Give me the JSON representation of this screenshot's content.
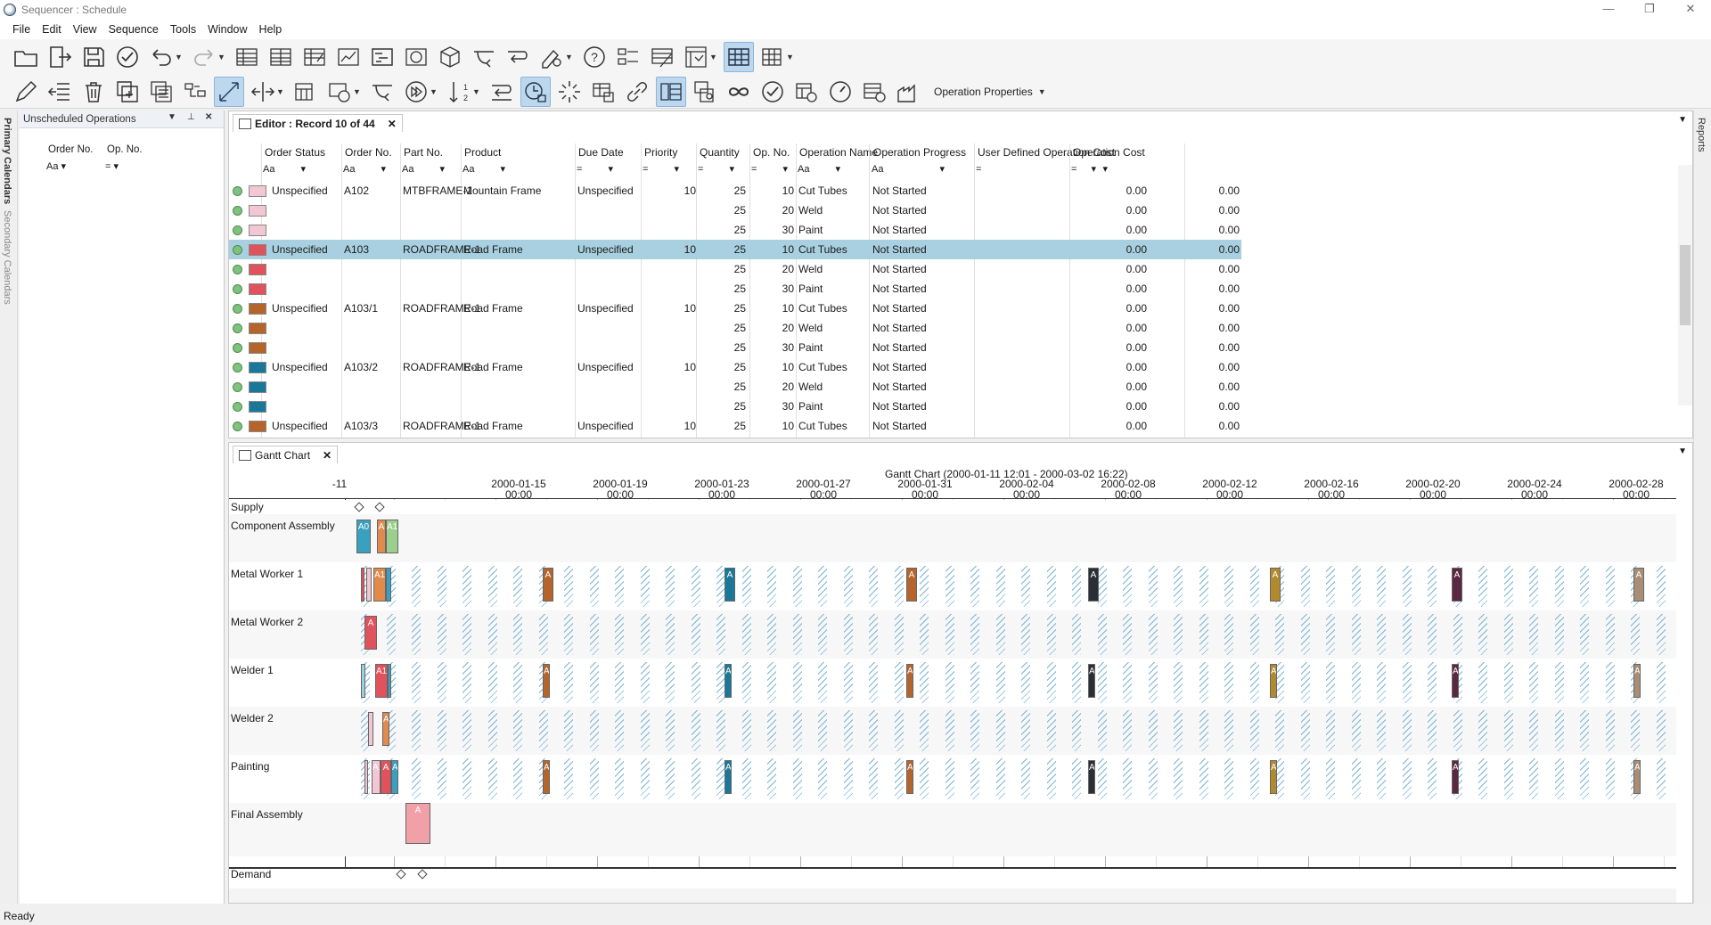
{
  "window": {
    "title": "Sequencer : Schedule",
    "controls": [
      "—",
      "❐",
      "✕"
    ]
  },
  "menu": [
    "File",
    "Edit",
    "View",
    "Sequence",
    "Tools",
    "Window",
    "Help"
  ],
  "toolbar": {
    "op_properties": "Operation Properties"
  },
  "side_tabs": {
    "primary": "Primary Calendars",
    "secondary": "Secondary Calendars",
    "reports": "Reports"
  },
  "unscheduled": {
    "title": "Unscheduled Operations",
    "columns": [
      "Order No.",
      "Op. No."
    ],
    "filters": [
      "Aa ▾",
      "= ▾"
    ]
  },
  "editor": {
    "tab_label": "Editor : Record 10 of 44",
    "columns": [
      "Order Status",
      "Order No.",
      "Part No.",
      "Product",
      "Due Date",
      "Priority",
      "Quantity",
      "Op. No.",
      "Operation Name",
      "Operation Progress",
      "User Defined Operation Cost",
      "Operation Cost"
    ],
    "filters": [
      "Aa",
      "Aa",
      "Aa",
      "Aa",
      "=",
      "=",
      "=",
      "=",
      "Aa",
      "Aa",
      "=",
      "="
    ],
    "rows": [
      {
        "color": "#f2c6d2",
        "status": "Unspecified",
        "order": "A102",
        "part": "MTBFRAME-1",
        "product": "Mountain Frame",
        "due": "Unspecified",
        "priority": "10",
        "qty": "25",
        "op": "10",
        "opname": "Cut Tubes",
        "progress": "Not Started",
        "udcost": "0.00",
        "cost": "0.00"
      },
      {
        "color": "#f2c6d2",
        "status": "",
        "order": "",
        "part": "",
        "product": "",
        "due": "",
        "priority": "",
        "qty": "25",
        "op": "20",
        "opname": "Weld",
        "progress": "Not Started",
        "udcost": "0.00",
        "cost": "0.00"
      },
      {
        "color": "#f2c6d2",
        "status": "",
        "order": "",
        "part": "",
        "product": "",
        "due": "",
        "priority": "",
        "qty": "25",
        "op": "30",
        "opname": "Paint",
        "progress": "Not Started",
        "udcost": "0.00",
        "cost": "0.00"
      },
      {
        "color": "#e0525c",
        "status": "Unspecified",
        "order": "A103",
        "part": "ROADFRAME-1",
        "product": "Road Frame",
        "due": "Unspecified",
        "priority": "10",
        "qty": "25",
        "op": "10",
        "opname": "Cut Tubes",
        "progress": "Not Started",
        "udcost": "0.00",
        "cost": "0.00",
        "selected": true
      },
      {
        "color": "#e0525c",
        "status": "",
        "order": "",
        "part": "",
        "product": "",
        "due": "",
        "priority": "",
        "qty": "25",
        "op": "20",
        "opname": "Weld",
        "progress": "Not Started",
        "udcost": "0.00",
        "cost": "0.00"
      },
      {
        "color": "#e0525c",
        "status": "",
        "order": "",
        "part": "",
        "product": "",
        "due": "",
        "priority": "",
        "qty": "25",
        "op": "30",
        "opname": "Paint",
        "progress": "Not Started",
        "udcost": "0.00",
        "cost": "0.00"
      },
      {
        "color": "#b5642c",
        "status": "Unspecified",
        "order": "A103/1",
        "part": "ROADFRAME-1",
        "product": "Road Frame",
        "due": "Unspecified",
        "priority": "10",
        "qty": "25",
        "op": "10",
        "opname": "Cut Tubes",
        "progress": "Not Started",
        "udcost": "0.00",
        "cost": "0.00"
      },
      {
        "color": "#b5642c",
        "status": "",
        "order": "",
        "part": "",
        "product": "",
        "due": "",
        "priority": "",
        "qty": "25",
        "op": "20",
        "opname": "Weld",
        "progress": "Not Started",
        "udcost": "0.00",
        "cost": "0.00"
      },
      {
        "color": "#b5642c",
        "status": "",
        "order": "",
        "part": "",
        "product": "",
        "due": "",
        "priority": "",
        "qty": "25",
        "op": "30",
        "opname": "Paint",
        "progress": "Not Started",
        "udcost": "0.00",
        "cost": "0.00"
      },
      {
        "color": "#19789a",
        "status": "Unspecified",
        "order": "A103/2",
        "part": "ROADFRAME-1",
        "product": "Road Frame",
        "due": "Unspecified",
        "priority": "10",
        "qty": "25",
        "op": "10",
        "opname": "Cut Tubes",
        "progress": "Not Started",
        "udcost": "0.00",
        "cost": "0.00"
      },
      {
        "color": "#19789a",
        "status": "",
        "order": "",
        "part": "",
        "product": "",
        "due": "",
        "priority": "",
        "qty": "25",
        "op": "20",
        "opname": "Weld",
        "progress": "Not Started",
        "udcost": "0.00",
        "cost": "0.00"
      },
      {
        "color": "#19789a",
        "status": "",
        "order": "",
        "part": "",
        "product": "",
        "due": "",
        "priority": "",
        "qty": "25",
        "op": "30",
        "opname": "Paint",
        "progress": "Not Started",
        "udcost": "0.00",
        "cost": "0.00"
      },
      {
        "color": "#b5642c",
        "status": "Unspecified",
        "order": "A103/3",
        "part": "ROADFRAME-1",
        "product": "Road Frame",
        "due": "Unspecified",
        "priority": "10",
        "qty": "25",
        "op": "10",
        "opname": "Cut Tubes",
        "progress": "Not Started",
        "udcost": "0.00",
        "cost": "0.00"
      }
    ]
  },
  "gantt": {
    "tab_label": "Gantt Chart",
    "range_title": "Gantt Chart  (2000-01-11 12:01 - 2000-03-02 16:22)",
    "dates": [
      "-11",
      "2000-01-15",
      "2000-01-19",
      "2000-01-23",
      "2000-01-27",
      "2000-01-31",
      "2000-02-04",
      "2000-02-08",
      "2000-02-12",
      "2000-02-16",
      "2000-02-20",
      "2000-02-24",
      "2000-02-28"
    ],
    "time": "00:00",
    "lanes": [
      "Supply",
      "Component Assembly",
      "Metal Worker 1",
      "Metal Worker 2",
      "Welder 1",
      "Welder 2",
      "Painting",
      "Final Assembly",
      "Demand"
    ],
    "bar_labels": {
      "a0": "A0",
      "a1": "A1",
      "a": "A",
      "aa": "A",
      "a1b": "A1",
      "aaa": "A"
    }
  },
  "status": "Ready"
}
